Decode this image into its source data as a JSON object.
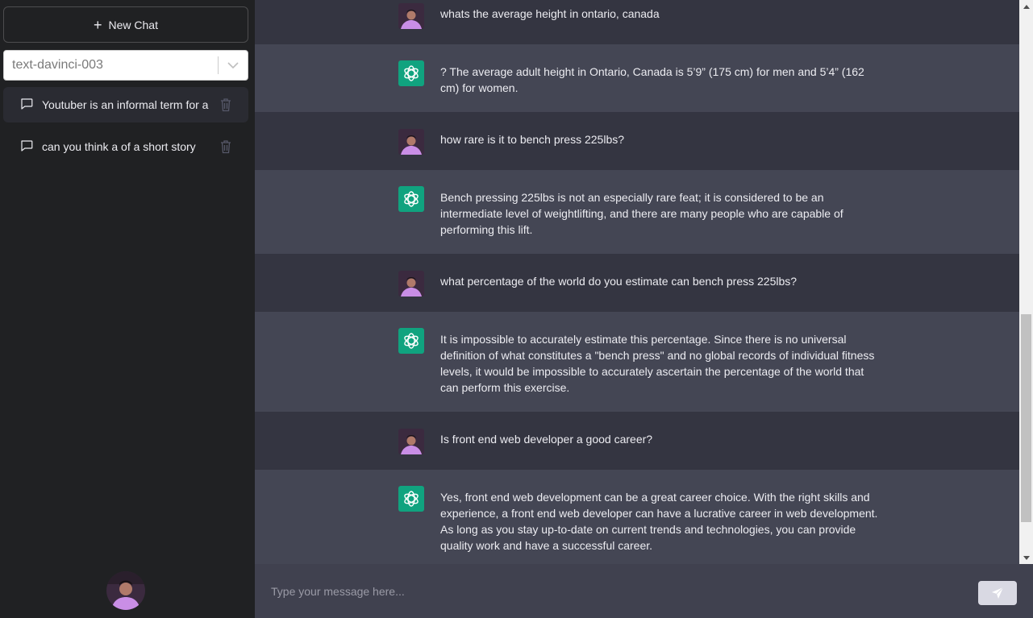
{
  "sidebar": {
    "new_chat_label": "New Chat",
    "model_value": "text-davinci-003",
    "conversations": [
      {
        "label": "Youtuber is an informal term for a",
        "active": true
      },
      {
        "label": "can you think a of a short story",
        "active": false
      }
    ]
  },
  "messages": [
    {
      "role": "user",
      "text": "whats the average height in ontario, canada"
    },
    {
      "role": "assistant",
      "text": "? The average adult height in Ontario, Canada is 5’9” (175 cm) for men and 5’4” (162 cm) for women."
    },
    {
      "role": "user",
      "text": "how rare is it to bench press 225lbs?"
    },
    {
      "role": "assistant",
      "text": "Bench pressing 225lbs is not an especially rare feat; it is considered to be an intermediate level of weightlifting, and there are many people who are capable of performing this lift."
    },
    {
      "role": "user",
      "text": "what percentage of the world do you estimate can bench press 225lbs?"
    },
    {
      "role": "assistant",
      "text": "It is impossible to accurately estimate this percentage. Since there is no universal definition of what constitutes a \"bench press\" and no global records of individual fitness levels, it would be impossible to accurately ascertain the percentage of the world that can perform this exercise."
    },
    {
      "role": "user",
      "text": "Is front end web developer a good career?"
    },
    {
      "role": "assistant",
      "text": "Yes, front end web development can be a great career choice. With the right skills and experience, a front end web developer can have a lucrative career in web development. As long as you stay up-to-date on current trends and technologies, you can provide quality work and have a successful career."
    }
  ],
  "composer": {
    "placeholder": "Type your message here..."
  },
  "icons": {
    "new_chat": "plus-icon",
    "dropdown": "chevron-down-icon",
    "conversation": "chat-bubble-icon",
    "delete": "trash-icon",
    "assistant_avatar": "openai-logo-icon",
    "send": "paper-plane-icon"
  },
  "colors": {
    "sidebar_bg": "#202123",
    "user_row_bg": "#343541",
    "assistant_row_bg": "#444654",
    "assistant_avatar_bg": "#10a37f",
    "composer_bg": "#40414f"
  }
}
